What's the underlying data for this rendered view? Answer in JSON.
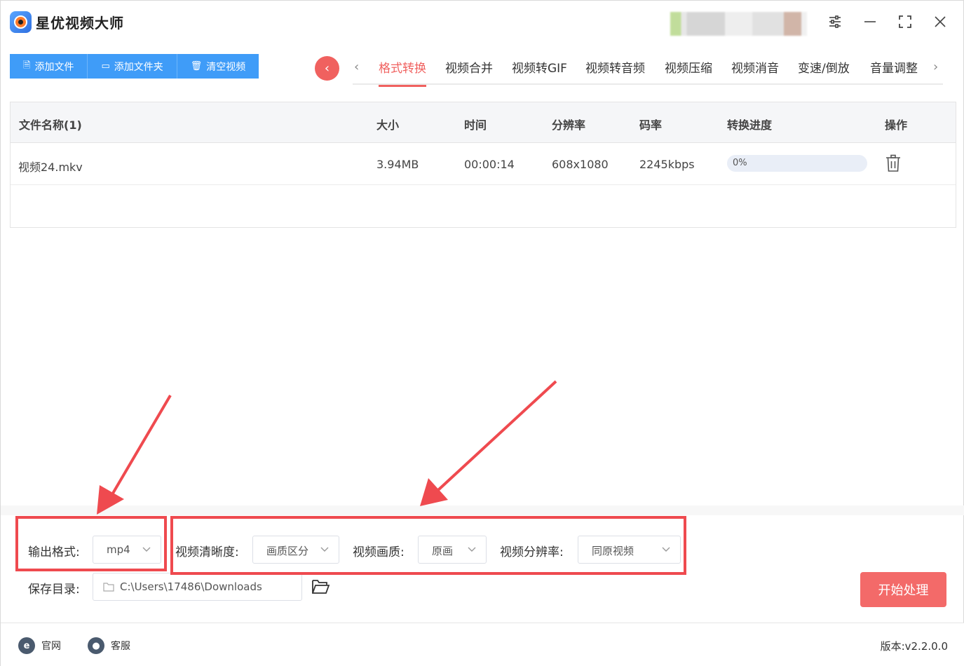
{
  "app": {
    "title": "星优视频大师"
  },
  "toolbar": {
    "add_file": "添加文件",
    "add_folder": "添加文件夹",
    "clear": "清空视频"
  },
  "tabs": [
    "格式转换",
    "视频合并",
    "视频转GIF",
    "视频转音频",
    "视频压缩",
    "视频消音",
    "变速/倒放",
    "音量调整"
  ],
  "active_tab": "格式转换",
  "table": {
    "headers": [
      "文件名称(1)",
      "大小",
      "时间",
      "分辨率",
      "码率",
      "转换进度",
      "操作"
    ],
    "rows": [
      {
        "name": "视频24.mkv",
        "size": "3.94MB",
        "duration": "00:00:14",
        "resolution": "608x1080",
        "bitrate": "2245kbps",
        "progress": "0%",
        "progress_value": 0
      }
    ]
  },
  "settings": {
    "output_format_label": "输出格式:",
    "output_format_value": "mp4",
    "clarity_label": "视频清晰度:",
    "clarity_value": "画质区分",
    "quality_label": "视频画质:",
    "quality_value": "原画",
    "resolution_label": "视频分辨率:",
    "resolution_value": "同原视频",
    "save_dir_label": "保存目录:",
    "save_dir_value": "C:\\Users\\17486\\Downloads"
  },
  "start_button": "开始处理",
  "footer": {
    "website": "官网",
    "support": "客服",
    "version": "版本:v2.2.0.0"
  },
  "colors": {
    "primary_blue": "#3f9cf8",
    "accent_red": "#f0615f",
    "annotation_red": "#ef4a4f"
  }
}
